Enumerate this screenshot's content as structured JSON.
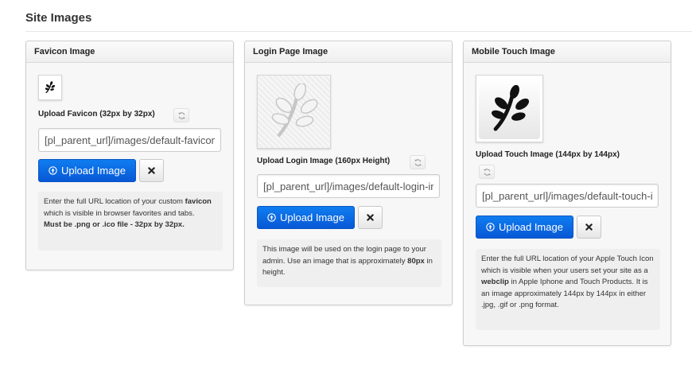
{
  "page": {
    "title": "Site Images"
  },
  "panels": {
    "favicon": {
      "title": "Favicon Image",
      "upload_label": "Upload Favicon (32px by 32px)",
      "url_value": "[pl_parent_url]/images/default-favicon.png",
      "upload_button": "Upload Image",
      "help": {
        "p1": "Enter the full URL location of your custom ",
        "strong1": "favicon",
        "p2": " which is visible in browser favorites and tabs.",
        "strong2": "Must be .png or .ico file - 32px by 32px."
      }
    },
    "login": {
      "title": "Login Page Image",
      "upload_label": "Upload Login Image (160px Height)",
      "url_value": "[pl_parent_url]/images/default-login-image.png",
      "upload_button": "Upload Image",
      "help": {
        "p1": "This image will be used on the login page to your admin. Use an image that is approximately ",
        "strong1": "80px",
        "p2": " in height."
      }
    },
    "touch": {
      "title": "Mobile Touch Image",
      "upload_label": "Upload Touch Image (144px by 144px)",
      "url_value": "[pl_parent_url]/images/default-touch-icon.png",
      "upload_button": "Upload Image",
      "help": {
        "p1": "Enter the full URL location of your Apple Touch Icon which is visible when your users set your site as a ",
        "strong1": "webclip",
        "p2": " in Apple Iphone and Touch Products. It is an image approximately 144px by 144px in either .jpg, .gif or .png format."
      }
    }
  },
  "icons": {
    "leaf": "leaf-icon",
    "refresh": "refresh-icon",
    "upload": "upload-circle-icon",
    "close": "close-icon"
  },
  "colors": {
    "primary_button": "#0a6ae6",
    "panel_bg": "#f7f7f7",
    "help_bg": "#efefef"
  }
}
